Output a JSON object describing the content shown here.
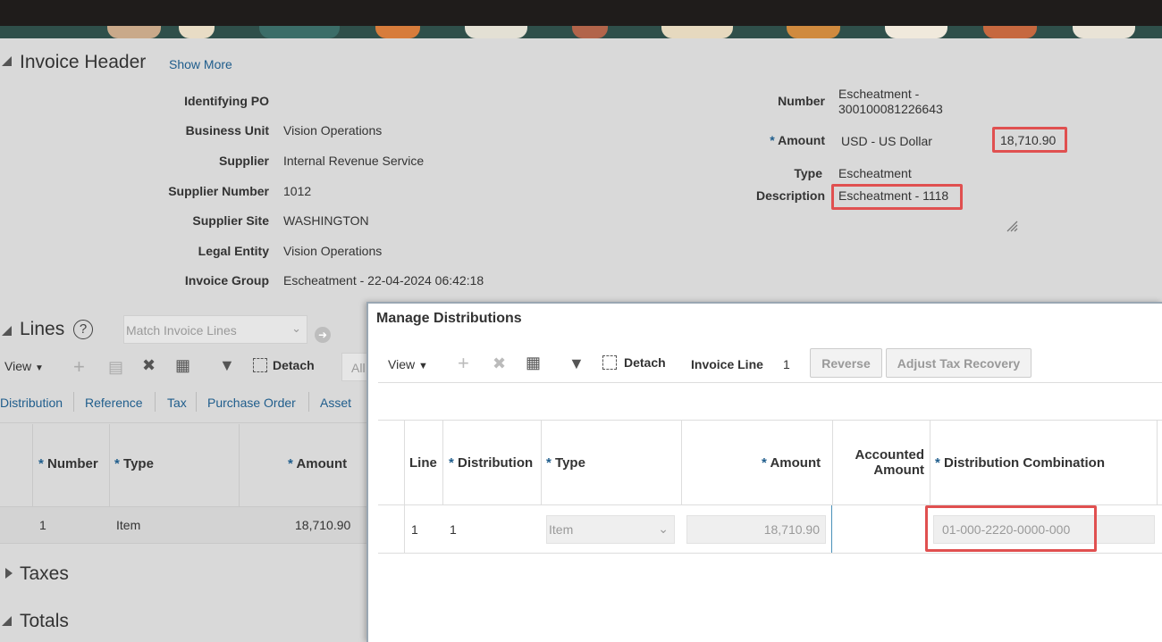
{
  "header": {
    "title": "Invoice Header",
    "show_more": "Show More",
    "fields_left": [
      {
        "label": "Identifying PO",
        "value": ""
      },
      {
        "label": "Business Unit",
        "value": "Vision Operations"
      },
      {
        "label": "Supplier",
        "value": "Internal Revenue Service"
      },
      {
        "label": "Supplier Number",
        "value": "1012"
      },
      {
        "label": "Supplier Site",
        "value": "WASHINGTON"
      },
      {
        "label": "Legal Entity",
        "value": "Vision Operations"
      },
      {
        "label": "Invoice Group",
        "value": "Escheatment - 22-04-2024 06:42:18"
      }
    ],
    "number_label": "Number",
    "number_value_line1": "Escheatment -",
    "number_value_line2": "300100081226643",
    "amount_label": "Amount",
    "amount_currency": "USD - US Dollar",
    "amount_value": "18,710.90",
    "type_label": "Type",
    "type_value": "Escheatment",
    "description_label": "Description",
    "description_value": "Escheatment - 1118"
  },
  "lines": {
    "title": "Lines",
    "help_icon": "question-circle-icon",
    "match_placeholder": "Match Invoice Lines",
    "view_label": "View",
    "detach_label": "Detach",
    "all_label": "All",
    "tabs": [
      "Distribution",
      "Reference",
      "Tax",
      "Purchase Order",
      "Asset"
    ],
    "columns": [
      "Number",
      "Type",
      "Amount"
    ],
    "row": {
      "number": "1",
      "type": "Item",
      "amount": "18,710.90"
    }
  },
  "taxes_title": "Taxes",
  "totals_title": "Totals",
  "dialog": {
    "title": "Manage Distributions",
    "view_label": "View",
    "detach_label": "Detach",
    "invoice_line_label": "Invoice Line",
    "invoice_line_value": "1",
    "reverse_button": "Reverse",
    "adjust_tax_button": "Adjust Tax Recovery",
    "columns": {
      "line": "Line",
      "distribution": "Distribution",
      "type": "Type",
      "amount": "Amount",
      "accounted_line1": "Accounted",
      "accounted_line2": "Amount",
      "combination": "Distribution Combination"
    },
    "row": {
      "line": "1",
      "distribution": "1",
      "type": "Item",
      "amount": "18,710.90",
      "accounted_amount": "",
      "combination": "01-000-2220-0000-000"
    }
  },
  "colors": {
    "link": "#1f5d8c",
    "highlight": "#e05050",
    "topbar": "#1f1c1b"
  }
}
